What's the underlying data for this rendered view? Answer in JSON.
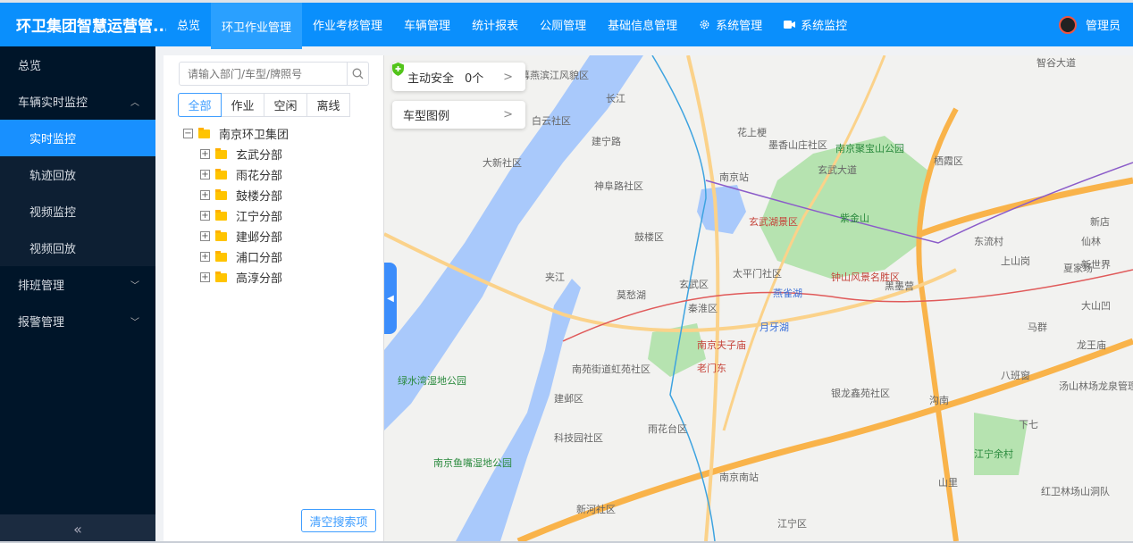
{
  "app": {
    "title": "环卫集团智慧运营管..."
  },
  "nav": [
    {
      "label": "总览"
    },
    {
      "label": "环卫作业管理",
      "active": true
    },
    {
      "label": "作业考核管理"
    },
    {
      "label": "车辆管理"
    },
    {
      "label": "统计报表"
    },
    {
      "label": "公厕管理"
    },
    {
      "label": "基础信息管理"
    },
    {
      "label": "系统管理",
      "icon": "gear-icon"
    },
    {
      "label": "系统监控",
      "icon": "camera-icon"
    }
  ],
  "user": {
    "name": "管理员"
  },
  "sidebar": {
    "items": [
      {
        "label": "总览"
      },
      {
        "label": "车辆实时监控",
        "expanded": true
      },
      {
        "label": "排班管理"
      },
      {
        "label": "报警管理"
      }
    ],
    "sub": [
      {
        "label": "实时监控",
        "active": true
      },
      {
        "label": "轨迹回放"
      },
      {
        "label": "视频监控"
      },
      {
        "label": "视频回放"
      }
    ],
    "collapse": "«"
  },
  "panel": {
    "search_placeholder": "请输入部门/车型/牌照号",
    "tabs": [
      {
        "label": "全部",
        "active": true
      },
      {
        "label": "作业"
      },
      {
        "label": "空闲"
      },
      {
        "label": "离线"
      }
    ],
    "root": "南京环卫集团",
    "children": [
      "玄武分部",
      "雨花分部",
      "鼓楼分部",
      "江宁分部",
      "建邺分部",
      "浦口分部",
      "高淳分部"
    ],
    "clear_label": "清空搜索项"
  },
  "map": {
    "safety": {
      "label": "主动安全",
      "count": "0个"
    },
    "legend": {
      "label": "车型图例"
    },
    "labels": [
      "南京幕燕滨江风貌区",
      "智谷大道",
      "大新社区",
      "南京站",
      "玄武湖景区",
      "紫金山",
      "钟山风景名胜区",
      "鼓楼区",
      "玄武区",
      "秦淮区",
      "燕雀湖",
      "月牙湖",
      "南京夫子庙",
      "老门东",
      "绿水湾湿地公园",
      "建邺区",
      "雨花台区",
      "南京鱼嘴湿地公园",
      "南京南站",
      "江宁区",
      "栖霞区",
      "江宁余村",
      "八班窗",
      "龙王庙",
      "汤山林场龙泉管理区",
      "红卫林场山洞队",
      "长江",
      "夹江",
      "玄武大道",
      "南京聚宝山公园",
      "沟南",
      "大山凹",
      "马群",
      "仙林",
      "上山岗",
      "新世界",
      "建宁路",
      "莫愁湖",
      "黑墨营",
      "花上梗",
      "白云社区",
      "墨香山庄社区",
      "神阜路社区",
      "太平门社区",
      "南苑街道虹苑社区",
      "科技园社区",
      "银龙鑫苑社区",
      "新河社区",
      "下七",
      "山里",
      "东流村",
      "新店",
      "夏家场"
    ]
  },
  "colors": {
    "header": "#0a8ffc",
    "sidebar": "#001529",
    "active": "#1890ff",
    "water": "#a9c9fb",
    "park": "#b6e3b0",
    "road": "#f9b34a"
  }
}
